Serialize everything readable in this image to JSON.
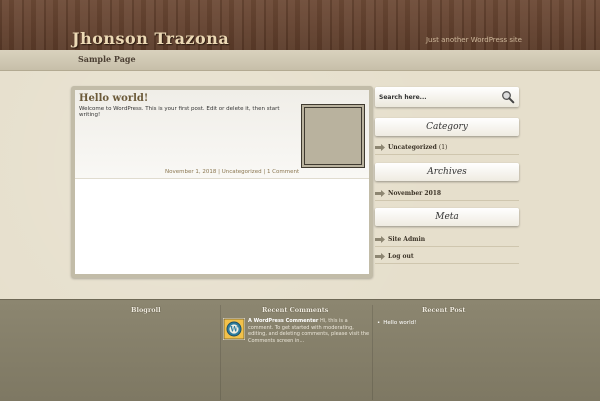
{
  "header": {
    "site_title": "Jhonson Trazona",
    "tagline": "Just another WordPress site"
  },
  "nav": {
    "items": [
      {
        "label": "Sample Page"
      }
    ]
  },
  "post": {
    "title": "Hello world!",
    "excerpt": "Welcome to WordPress. This is your first post. Edit or delete it, then start writing!",
    "meta": {
      "date": "November 1, 2018",
      "category": "Uncategorized",
      "comments": "1 Comment",
      "separator": "|"
    }
  },
  "sidebar": {
    "search": {
      "placeholder": "Search here..."
    },
    "widgets": [
      {
        "title": "Category",
        "items": [
          {
            "label": "Uncategorized",
            "count": "(1)"
          }
        ]
      },
      {
        "title": "Archives",
        "items": [
          {
            "label": "November 2018"
          }
        ]
      },
      {
        "title": "Meta",
        "items": [
          {
            "label": "Site Admin"
          },
          {
            "label": "Log out"
          }
        ]
      }
    ]
  },
  "footer": {
    "blogroll": {
      "title": "Blogroll"
    },
    "recent_comments": {
      "title": "Recent Comments",
      "author": "A WordPress Commenter",
      "text": "Hi, this is a comment. To get started with moderating, editing, and deleting comments, please visit the Comments screen in..."
    },
    "recent_post": {
      "title": "Recent Post",
      "items": [
        {
          "label": "Hello world!"
        }
      ]
    }
  },
  "colors": {
    "header_wood": "#5f3f2c",
    "title_text": "#ecd9b5",
    "nav_bar": "#d1c9b4",
    "page_bg": "#e6dfcc",
    "footer_bg": "#858069",
    "post_frame": "#c2bca8"
  },
  "icons": {
    "search": "magnifier-icon",
    "widget_bullet": "arrow-right-icon",
    "avatar": "wordpress-avatar-icon"
  }
}
